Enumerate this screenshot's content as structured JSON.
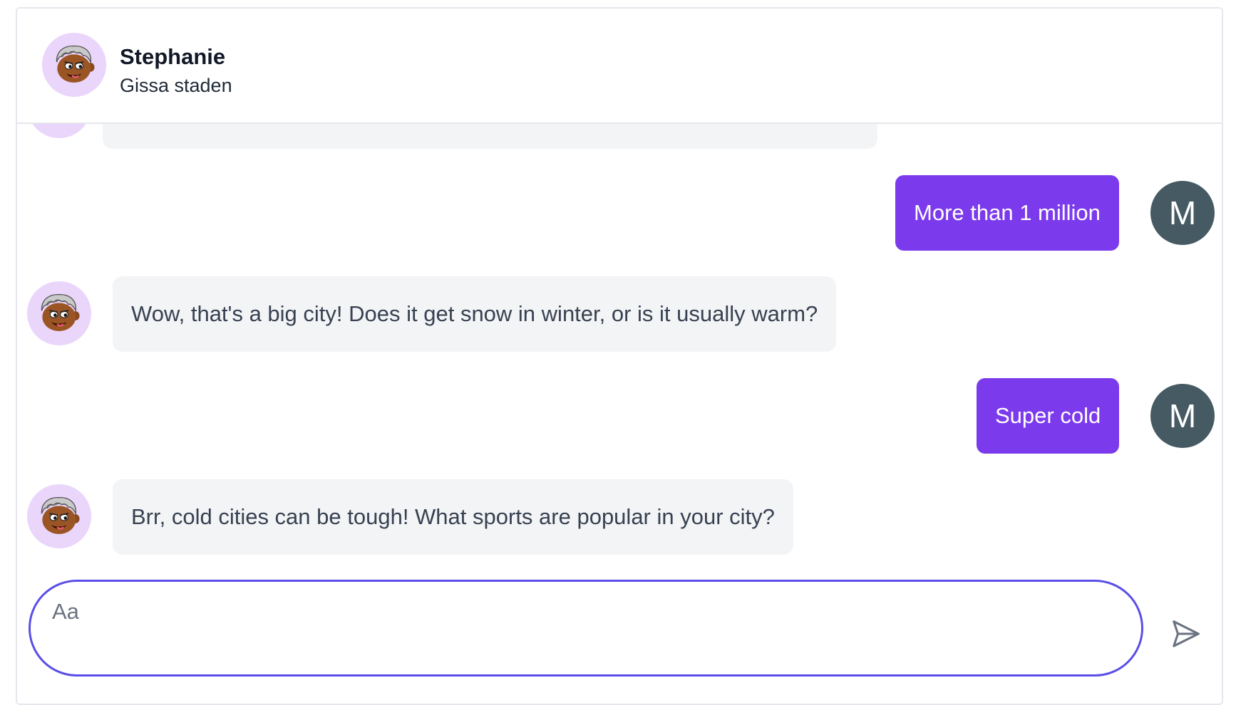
{
  "header": {
    "name": "Stephanie",
    "subtitle": "Gissa staden",
    "avatar_icon": "cartoon-face-icon"
  },
  "messages": [
    {
      "sender": "bot",
      "text": ""
    },
    {
      "sender": "user",
      "text": "More than 1 million",
      "avatar_letter": "M"
    },
    {
      "sender": "bot",
      "text": "Wow, that's a big city! Does it get snow in winter, or is it usually warm?"
    },
    {
      "sender": "user",
      "text": "Super cold",
      "avatar_letter": "M"
    },
    {
      "sender": "bot",
      "text": "Brr, cold cities can be tough! What sports are popular in your city?"
    }
  ],
  "composer": {
    "placeholder": "Aa",
    "value": "",
    "send_icon": "send-icon"
  },
  "colors": {
    "user_bubble": "#7c3aed",
    "bot_bubble": "#f3f4f6",
    "user_avatar": "#465a63",
    "bot_avatar_bg": "#ead5fb",
    "composer_border": "#5b4ee8"
  }
}
